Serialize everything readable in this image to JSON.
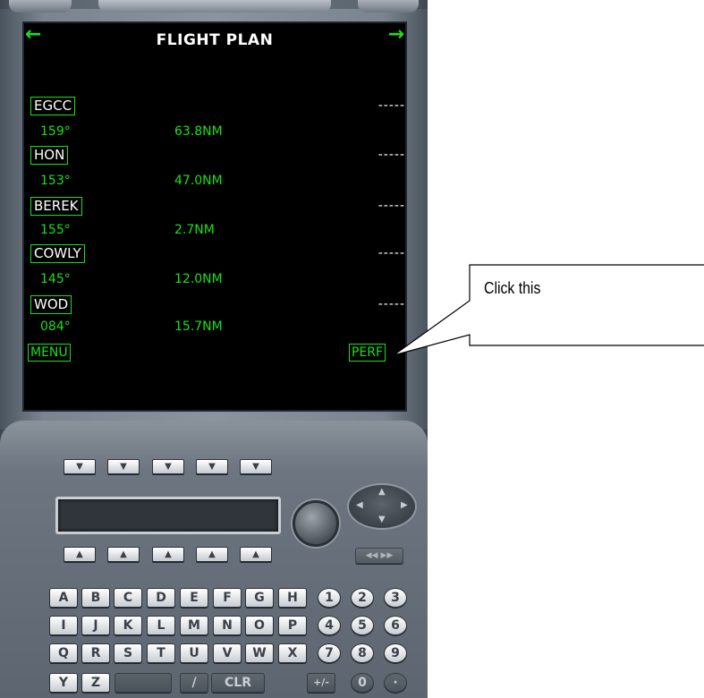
{
  "screen": {
    "title": "FLIGHT PLAN",
    "waypoints": [
      {
        "name": "EGCC",
        "eta": "-----",
        "course": "159°",
        "distance": "63.8NM"
      },
      {
        "name": "HON",
        "eta": "-----",
        "course": "153°",
        "distance": "47.0NM"
      },
      {
        "name": "BEREK",
        "eta": "-----",
        "course": "155°",
        "distance": "2.7NM"
      },
      {
        "name": "COWLY",
        "eta": "-----",
        "course": "145°",
        "distance": "12.0NM"
      },
      {
        "name": "WOD",
        "eta": "-----",
        "course": "084°",
        "distance": "15.7NM"
      }
    ],
    "menu_label": "MENU",
    "perf_label": "PERF",
    "accent_color": "#19e019"
  },
  "keyboard": {
    "upper_lsk": [
      "▼",
      "▼",
      "▼",
      "▼",
      "▼"
    ],
    "lower_lsk": [
      "▲",
      "▲",
      "▲",
      "▲",
      "▲"
    ],
    "page_keys": "◀◀ ▶▶",
    "rows": [
      [
        "A",
        "B",
        "C",
        "D",
        "E",
        "F",
        "G",
        "H",
        "1",
        "2",
        "3"
      ],
      [
        "I",
        "J",
        "K",
        "L",
        "M",
        "N",
        "O",
        "P",
        "4",
        "5",
        "6"
      ],
      [
        "Q",
        "R",
        "S",
        "T",
        "U",
        "V",
        "W",
        "X",
        "7",
        "8",
        "9"
      ]
    ],
    "last_row": {
      "y": "Y",
      "z": "Z",
      "slash": "/",
      "clr": "CLR",
      "plusminus": "+/-",
      "zero": "0",
      "dot": "·"
    }
  },
  "callout": {
    "text": "Click this"
  }
}
